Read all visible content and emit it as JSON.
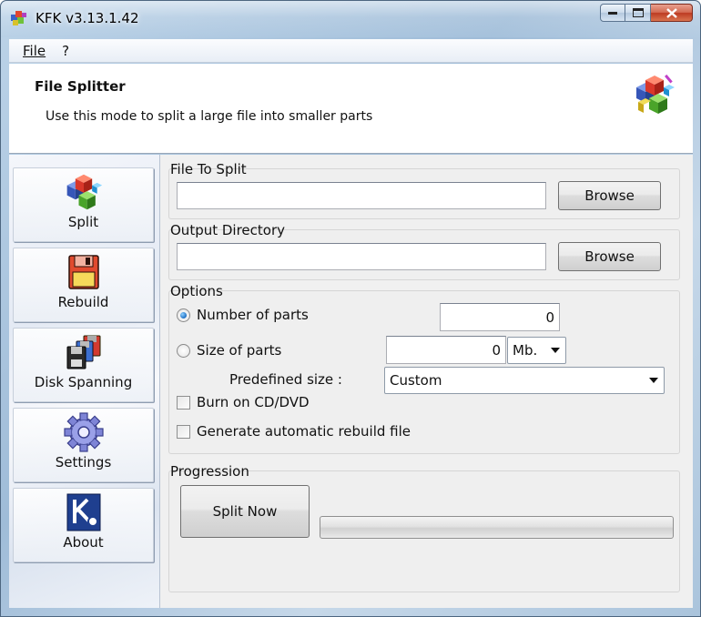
{
  "window": {
    "title": "KFK v3.13.1.42"
  },
  "menu": [
    {
      "label": "File",
      "accesskey": "F"
    },
    {
      "label": "?"
    }
  ],
  "header": {
    "title": "File Splitter",
    "description": "Use this mode to split a large file into smaller parts"
  },
  "sidebar": {
    "items": [
      {
        "label": "Split",
        "icon": "split-cubes-icon"
      },
      {
        "label": "Rebuild",
        "icon": "rebuild-floppy-icon"
      },
      {
        "label": "Disk Spanning",
        "icon": "disk-spanning-icon"
      },
      {
        "label": "Settings",
        "icon": "gear-icon"
      },
      {
        "label": "About",
        "icon": "about-k-icon"
      }
    ]
  },
  "file_to_split": {
    "label": "File To Split",
    "value": "",
    "browse_label": "Browse"
  },
  "output_directory": {
    "label": "Output Directory",
    "value": "",
    "browse_label": "Browse"
  },
  "options": {
    "label": "Options",
    "number_of_parts": {
      "label": "Number of parts",
      "value": "0",
      "selected": true
    },
    "size_of_parts": {
      "label": "Size of parts",
      "value": "0",
      "selected": false,
      "unit": "Mb."
    },
    "predefined_size": {
      "label": "Predefined size :",
      "value": "Custom"
    },
    "burn_cd": {
      "label": "Burn on CD/DVD",
      "checked": false
    },
    "generate_rebuild": {
      "label": "Generate automatic rebuild file",
      "checked": false
    }
  },
  "progression": {
    "label": "Progression",
    "button_label": "Split Now",
    "progress": 0
  }
}
